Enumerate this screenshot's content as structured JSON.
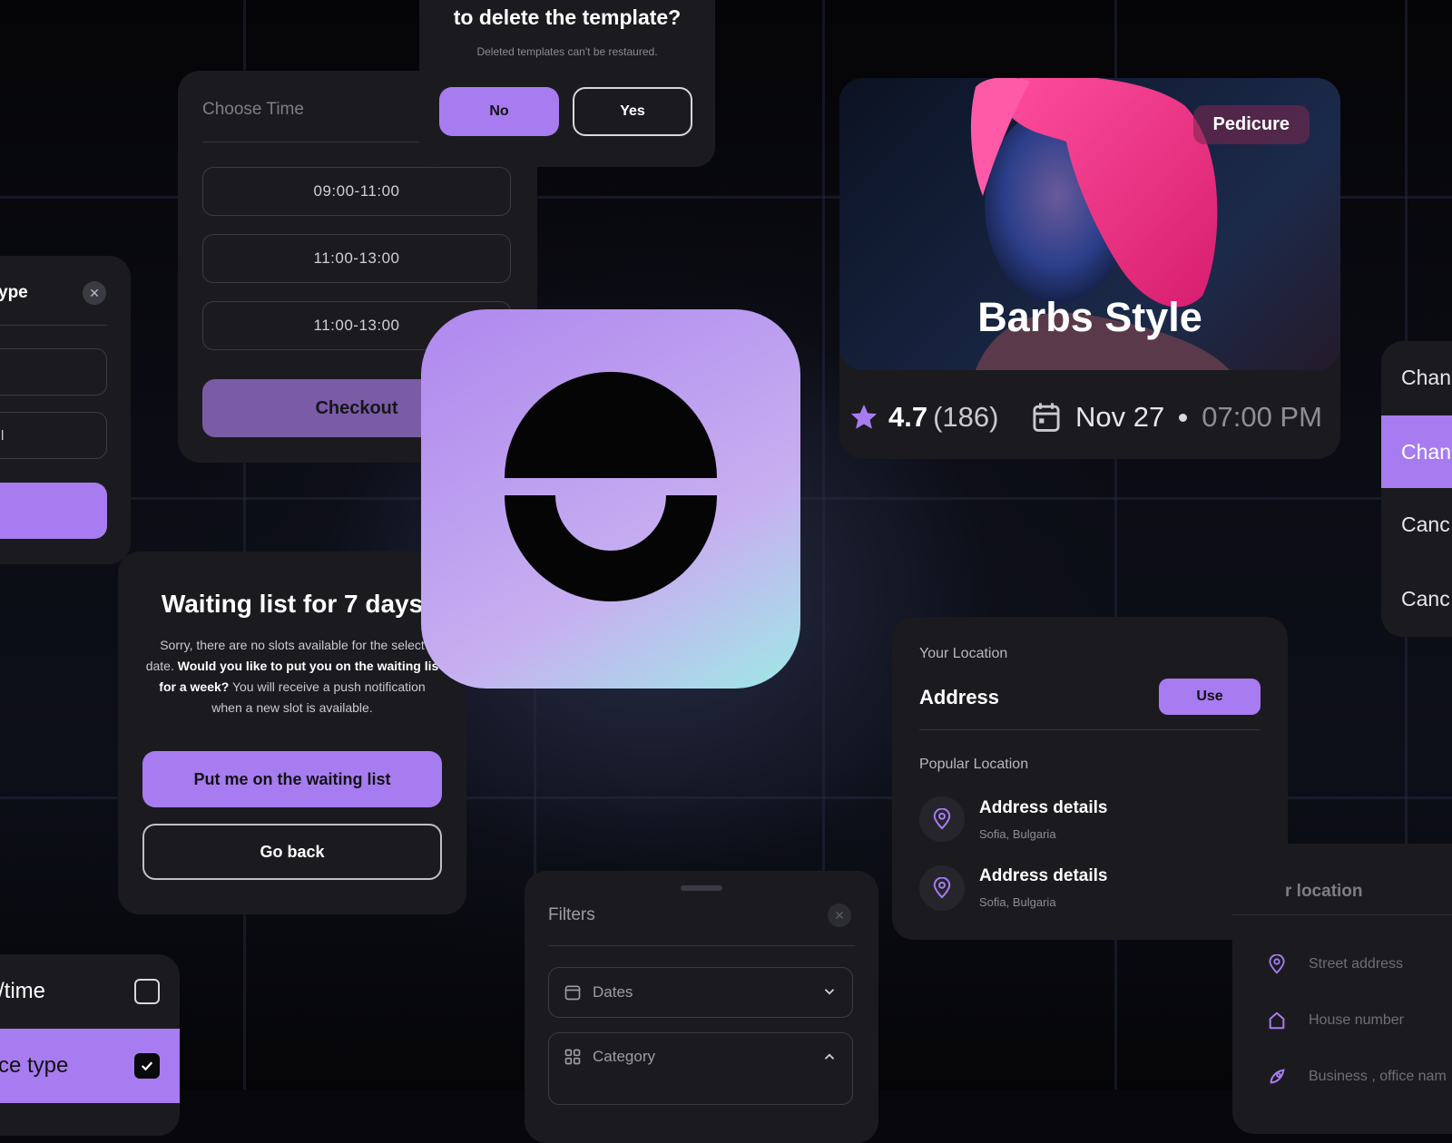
{
  "delete_dialog": {
    "title": "to delete the template?",
    "subtitle": "Deleted templates can't be restaured.",
    "no_label": "No",
    "yes_label": "Yes"
  },
  "choose_time": {
    "heading": "Choose Time",
    "slots": [
      "09:00-11:00",
      "11:00-13:00",
      "11:00-13:00"
    ],
    "checkout_label": "Checkout"
  },
  "type_panel": {
    "title": "ype",
    "field2_value": "l"
  },
  "waiting_list": {
    "title": "Waiting list for 7 days",
    "body_1": "Sorry, there are no slots available for the select",
    "body_2": "date. ",
    "body_3": "Would you like to put you on the waiting lis",
    "body_4": "for a week?",
    "body_5": " You will receive a push notification",
    "body_6": "when a new slot is available.",
    "primary_label": "Put me on the waiting list",
    "secondary_label": "Go back"
  },
  "salon": {
    "badge": "Pedicure",
    "name": "Barbs Style",
    "rating": "4.7",
    "reviews": "(186)",
    "date": "Nov 27",
    "time": "07:00 PM"
  },
  "status_list": {
    "items": [
      "Chan",
      "Chan",
      "Canc",
      "Canc"
    ],
    "selected_index": 1
  },
  "location": {
    "your_location_label": "Your Location",
    "address_label": "Address",
    "use_label": "Use",
    "popular_label": "Popular Location",
    "items": [
      {
        "title": "Address details",
        "subtitle": "Sofia, Bulgaria"
      },
      {
        "title": "Address details",
        "subtitle": "Sofia, Bulgaria"
      }
    ]
  },
  "filters": {
    "title": "Filters",
    "dates_label": "Dates",
    "category_label": "Category"
  },
  "address_form": {
    "title": "r location",
    "street_placeholder": "Street address",
    "house_placeholder": "House number",
    "business_placeholder": "Business , office nam"
  },
  "check_list": {
    "items": [
      {
        "label": "/time",
        "checked": false
      },
      {
        "label": "ce type",
        "checked": true
      }
    ]
  },
  "colors": {
    "accent": "#a77cf0",
    "card": "#1b1b1f",
    "background": "#08080c"
  }
}
